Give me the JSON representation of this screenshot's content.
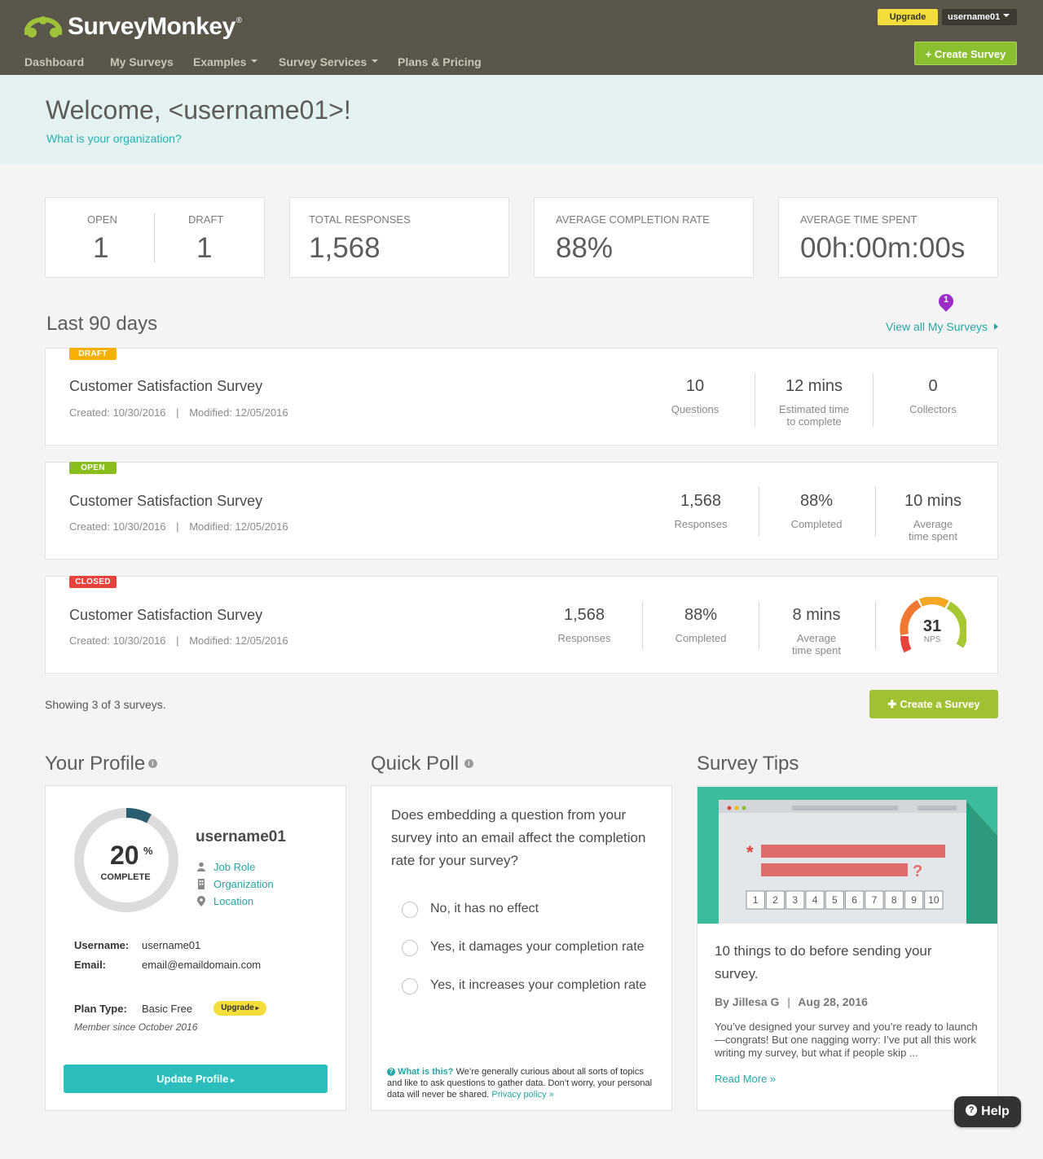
{
  "header": {
    "logo_text": "SurveyMonkey",
    "logo_reg": "®",
    "nav": [
      "Dashboard",
      "My Surveys",
      "Examples",
      "Survey Services",
      "Plans & Pricing"
    ],
    "upgrade_label": "Upgrade",
    "username": "username01",
    "create_survey_label": "+ Create Survey"
  },
  "welcome": {
    "title": "Welcome, <username01>!",
    "org_link": "What is your organization?"
  },
  "stats": {
    "open_label": "OPEN",
    "open_value": "1",
    "draft_label": "DRAFT",
    "draft_value": "1",
    "total_responses_label": "TOTAL RESPONSES",
    "total_responses_value": "1,568",
    "avg_completion_label": "AVERAGE COMPLETION RATE",
    "avg_completion_value": "88%",
    "avg_time_label": "AVERAGE TIME SPENT",
    "avg_time_value": "00h:00m:00s"
  },
  "last90": {
    "title": "Last 90 days",
    "view_all": "View all My Surveys",
    "pin_count": "1"
  },
  "surveys": [
    {
      "status": "DRAFT",
      "status_color": "#f7a600",
      "name": "Customer Satisfaction Survey",
      "created": "Created: 10/30/2016",
      "separator": "|",
      "modified": "Modified: 12/05/2016",
      "metrics": [
        {
          "value": "10",
          "label": "Questions"
        },
        {
          "value": "12 mins",
          "label1": "Estimated time",
          "label2": "to complete"
        },
        {
          "value": "0",
          "label": "Collectors"
        }
      ]
    },
    {
      "status": "OPEN",
      "status_color": "#88bd1c",
      "name": "Customer Satisfaction Survey",
      "created": "Created: 10/30/2016",
      "separator": "|",
      "modified": "Modified: 12/05/2016",
      "metrics": [
        {
          "value": "1,568",
          "label": "Responses"
        },
        {
          "value": "88%",
          "label": "Completed"
        },
        {
          "value": "10 mins",
          "label1": "Average",
          "label2": "time spent"
        }
      ]
    },
    {
      "status": "CLOSED",
      "status_color": "#e8423c",
      "name": "Customer Satisfaction Survey",
      "created": "Created: 10/30/2016",
      "separator": "|",
      "modified": "Modified: 12/05/2016",
      "metrics": [
        {
          "value": "1,568",
          "label": "Responses"
        },
        {
          "value": "88%",
          "label": "Completed"
        },
        {
          "value": "8 mins",
          "label1": "Average",
          "label2": "time spent"
        }
      ],
      "nps": {
        "value": "31",
        "label": "NPS"
      }
    }
  ],
  "showing": "Showing 3 of 3 surveys.",
  "create_survey2": "Create a Survey",
  "profile": {
    "title": "Your Profile",
    "percent": "20",
    "percent_sign": "%",
    "percent_fraction": 0.2,
    "complete_label": "COMPLETE",
    "username": "username01",
    "links": [
      "Job Role",
      "Organization",
      "Location"
    ],
    "username_label": "Username:",
    "username_value": "username01",
    "email_label": "Email:",
    "email_value": "email@emaildomain.com",
    "plan_label": "Plan Type:",
    "plan_value": "Basic Free",
    "upgrade_label": "Upgrade",
    "member_since": "Member since October 2016",
    "update_label": "Update Profile"
  },
  "poll": {
    "title": "Quick Poll",
    "question": "Does embedding a question from your survey into an email affect the completion rate for your survey?",
    "options": [
      "No, it has no effect",
      "Yes, it damages your completion rate",
      "Yes, it increases your completion rate"
    ],
    "what_is_this": "What is this?",
    "footnote": "We’re generally curious about all sorts of topics and like to ask questions to gather data. Don’t worry, your personal data will never be shared.",
    "privacy_link": "Privacy policy »"
  },
  "tips": {
    "title": "Survey Tips",
    "scale": [
      "1",
      "2",
      "3",
      "4",
      "5",
      "6",
      "7",
      "8",
      "9",
      "10"
    ],
    "asterisk": "*",
    "question_mark": "?",
    "article_title": "10 things to do before sending your survey.",
    "author": "By Jillesa G",
    "separator": "|",
    "date": "Aug 28, 2016",
    "excerpt": "You’ve designed your survey and you’re ready to launch—congrats! But one nagging worry: I’ve put all this work writing my survey, but what if people skip ...",
    "read_more": "Read More »"
  },
  "help_label": "Help",
  "colors": {
    "header_bg": "#5a5649",
    "teal": "#27b1b1",
    "green": "#8cbf2f"
  }
}
